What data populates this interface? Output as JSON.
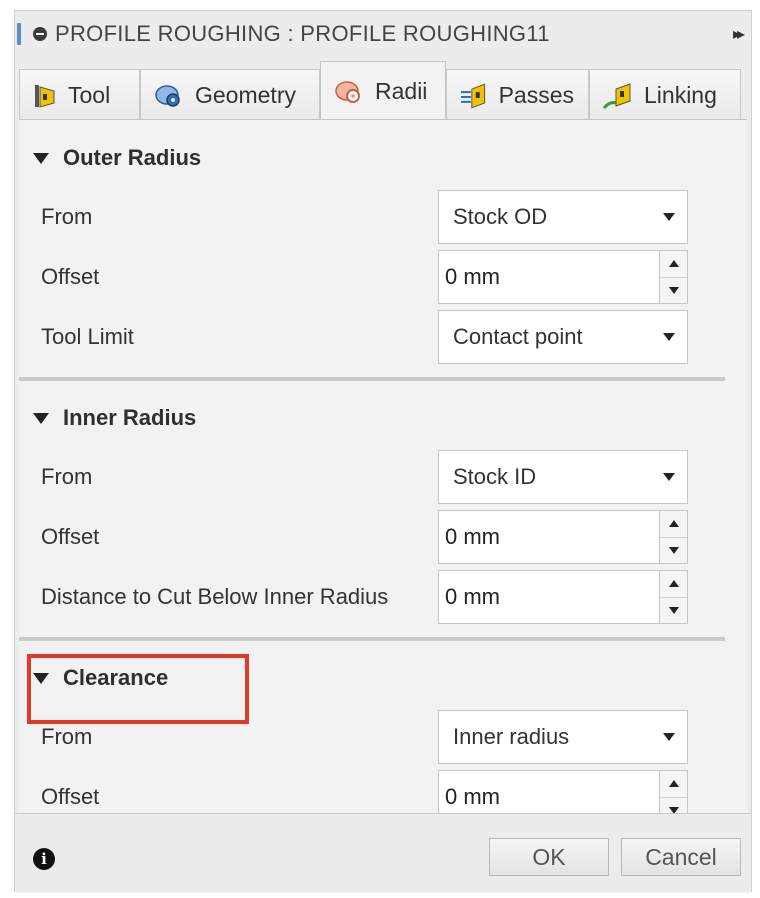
{
  "window": {
    "title": "PROFILE ROUGHING : PROFILE ROUGHING11",
    "expand_glyph": "▸▸"
  },
  "tabs": [
    {
      "label": "Tool",
      "icon": "tool-icon",
      "active": false
    },
    {
      "label": "Geometry",
      "icon": "geometry-icon",
      "active": false
    },
    {
      "label": "Radii",
      "icon": "radii-icon",
      "active": true
    },
    {
      "label": "Passes",
      "icon": "passes-icon",
      "active": false
    },
    {
      "label": "Linking",
      "icon": "linking-icon",
      "active": false
    }
  ],
  "outer_radius": {
    "title": "Outer Radius",
    "from_label": "From",
    "from_value": "Stock OD",
    "offset_label": "Offset",
    "offset_value": "0 mm",
    "tool_limit_label": "Tool Limit",
    "tool_limit_value": "Contact point"
  },
  "inner_radius": {
    "title": "Inner Radius",
    "from_label": "From",
    "from_value": "Stock ID",
    "offset_label": "Offset",
    "offset_value": "0 mm",
    "distance_label": "Distance to Cut Below Inner Radius",
    "distance_value": "0 mm"
  },
  "clearance": {
    "title": "Clearance",
    "from_label": "From",
    "from_value": "Inner radius",
    "offset_label": "Offset",
    "offset_value": "0 mm"
  },
  "footer": {
    "info_glyph": "i",
    "ok_label": "OK",
    "cancel_label": "Cancel"
  },
  "colors": {
    "highlight": "#e23a2a",
    "accent": "#5a8ed0"
  }
}
